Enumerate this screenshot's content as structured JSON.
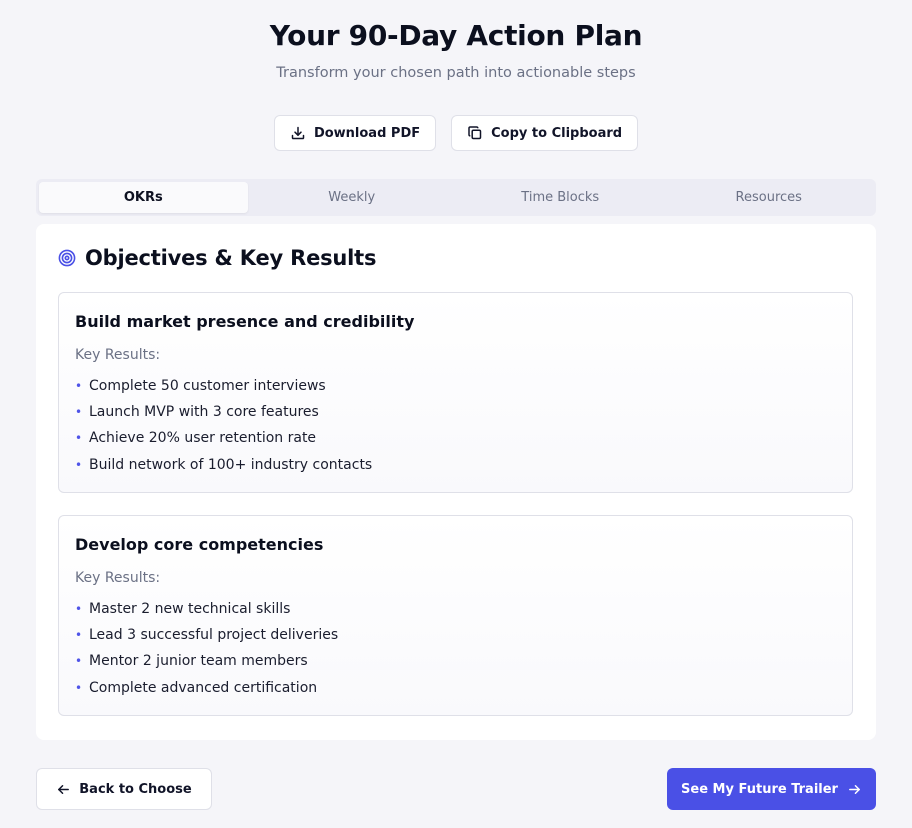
{
  "header": {
    "title": "Your 90-Day Action Plan",
    "subtitle": "Transform your chosen path into actionable steps"
  },
  "actions": {
    "download_label": "Download PDF",
    "download_icon": "download-icon",
    "copy_label": "Copy to Clipboard",
    "copy_icon": "copy-icon"
  },
  "tabs": [
    {
      "label": "OKRs",
      "active": true
    },
    {
      "label": "Weekly",
      "active": false
    },
    {
      "label": "Time Blocks",
      "active": false
    },
    {
      "label": "Resources",
      "active": false
    }
  ],
  "panel": {
    "icon": "target-icon",
    "title": "Objectives & Key Results",
    "objectives": [
      {
        "title": "Build market presence and credibility",
        "kr_label": "Key Results:",
        "key_results": [
          "Complete 50 customer interviews",
          "Launch MVP with 3 core features",
          "Achieve 20% user retention rate",
          "Build network of 100+ industry contacts"
        ]
      },
      {
        "title": "Develop core competencies",
        "kr_label": "Key Results:",
        "key_results": [
          "Master 2 new technical skills",
          "Lead 3 successful project deliveries",
          "Mentor 2 junior team members",
          "Complete advanced certification"
        ]
      }
    ]
  },
  "footer": {
    "back_label": "Back to Choose",
    "next_label": "See My Future Trailer"
  },
  "colors": {
    "accent": "#4a50e6",
    "bullet": "#4f54e8",
    "background": "#f5f5f9"
  }
}
